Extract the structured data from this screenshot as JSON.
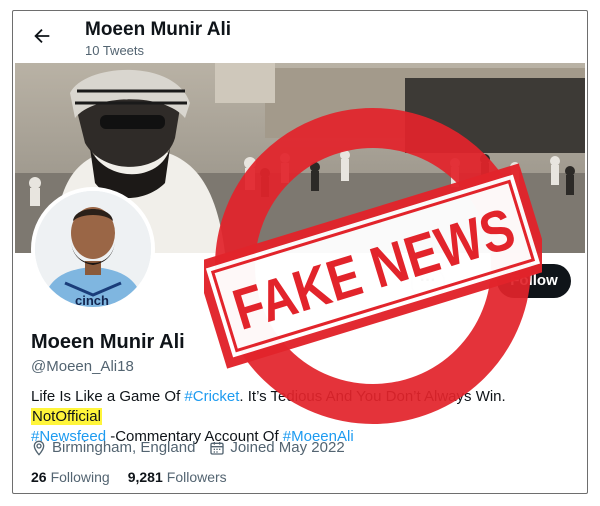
{
  "header": {
    "name": "Moeen Munir Ali",
    "tweets": "10 Tweets",
    "back_icon": "arrow-left-icon"
  },
  "profile": {
    "name": "Moeen Munir Ali",
    "handle": "@Moeen_Ali18",
    "bio": {
      "part1": "Life Is Like a Game Of ",
      "tag1": "#Cricket",
      "part2": ". It’s Tedious And You Don’t Always Win. ",
      "highlight": "NotOfficial",
      "tag2": "#Newsfeed",
      "part3": " -Commentary Account Of ",
      "tag3": "#MoeenAli"
    },
    "location": "Birmingham, England",
    "joined": "Joined May 2022",
    "following_count": "26",
    "following_label": "Following",
    "followers_count": "9,281",
    "followers_label": "Followers",
    "jersey_text": "cinch"
  },
  "actions": {
    "more_label": "···",
    "follow_label": "Follow"
  },
  "stamp": {
    "text": "FAKE NEWS",
    "color": "#e2242b"
  },
  "colors": {
    "link": "#1d9bf0",
    "highlight": "#fff53a",
    "text": "#0f1419",
    "muted": "#536471"
  }
}
